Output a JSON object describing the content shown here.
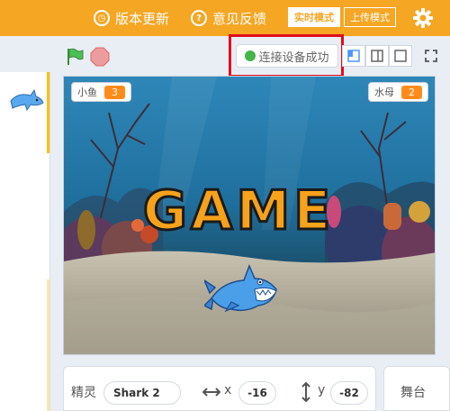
{
  "topbar": {
    "update_label": "版本更新",
    "feedback_label": "意见反馈",
    "realtime_mode": "实时模式",
    "upload_mode": "上传模式"
  },
  "stage_controls": {
    "connection_status": "连接设备成功"
  },
  "variables": [
    {
      "name": "小鱼",
      "value": "3"
    },
    {
      "name": "水母",
      "value": "2"
    }
  ],
  "stage": {
    "game_text": "GAME"
  },
  "sprite_info": {
    "sprite_label": "精灵",
    "sprite_name": "Shark 2",
    "x_label": "x",
    "x_value": "-16",
    "y_label": "y",
    "y_value": "-82"
  },
  "stage_panel": {
    "label": "舞台"
  },
  "colors": {
    "accent": "#f5a623",
    "highlight_box": "#e10d1d",
    "connected": "#44b54a",
    "variable_value": "#ff8c1a"
  }
}
